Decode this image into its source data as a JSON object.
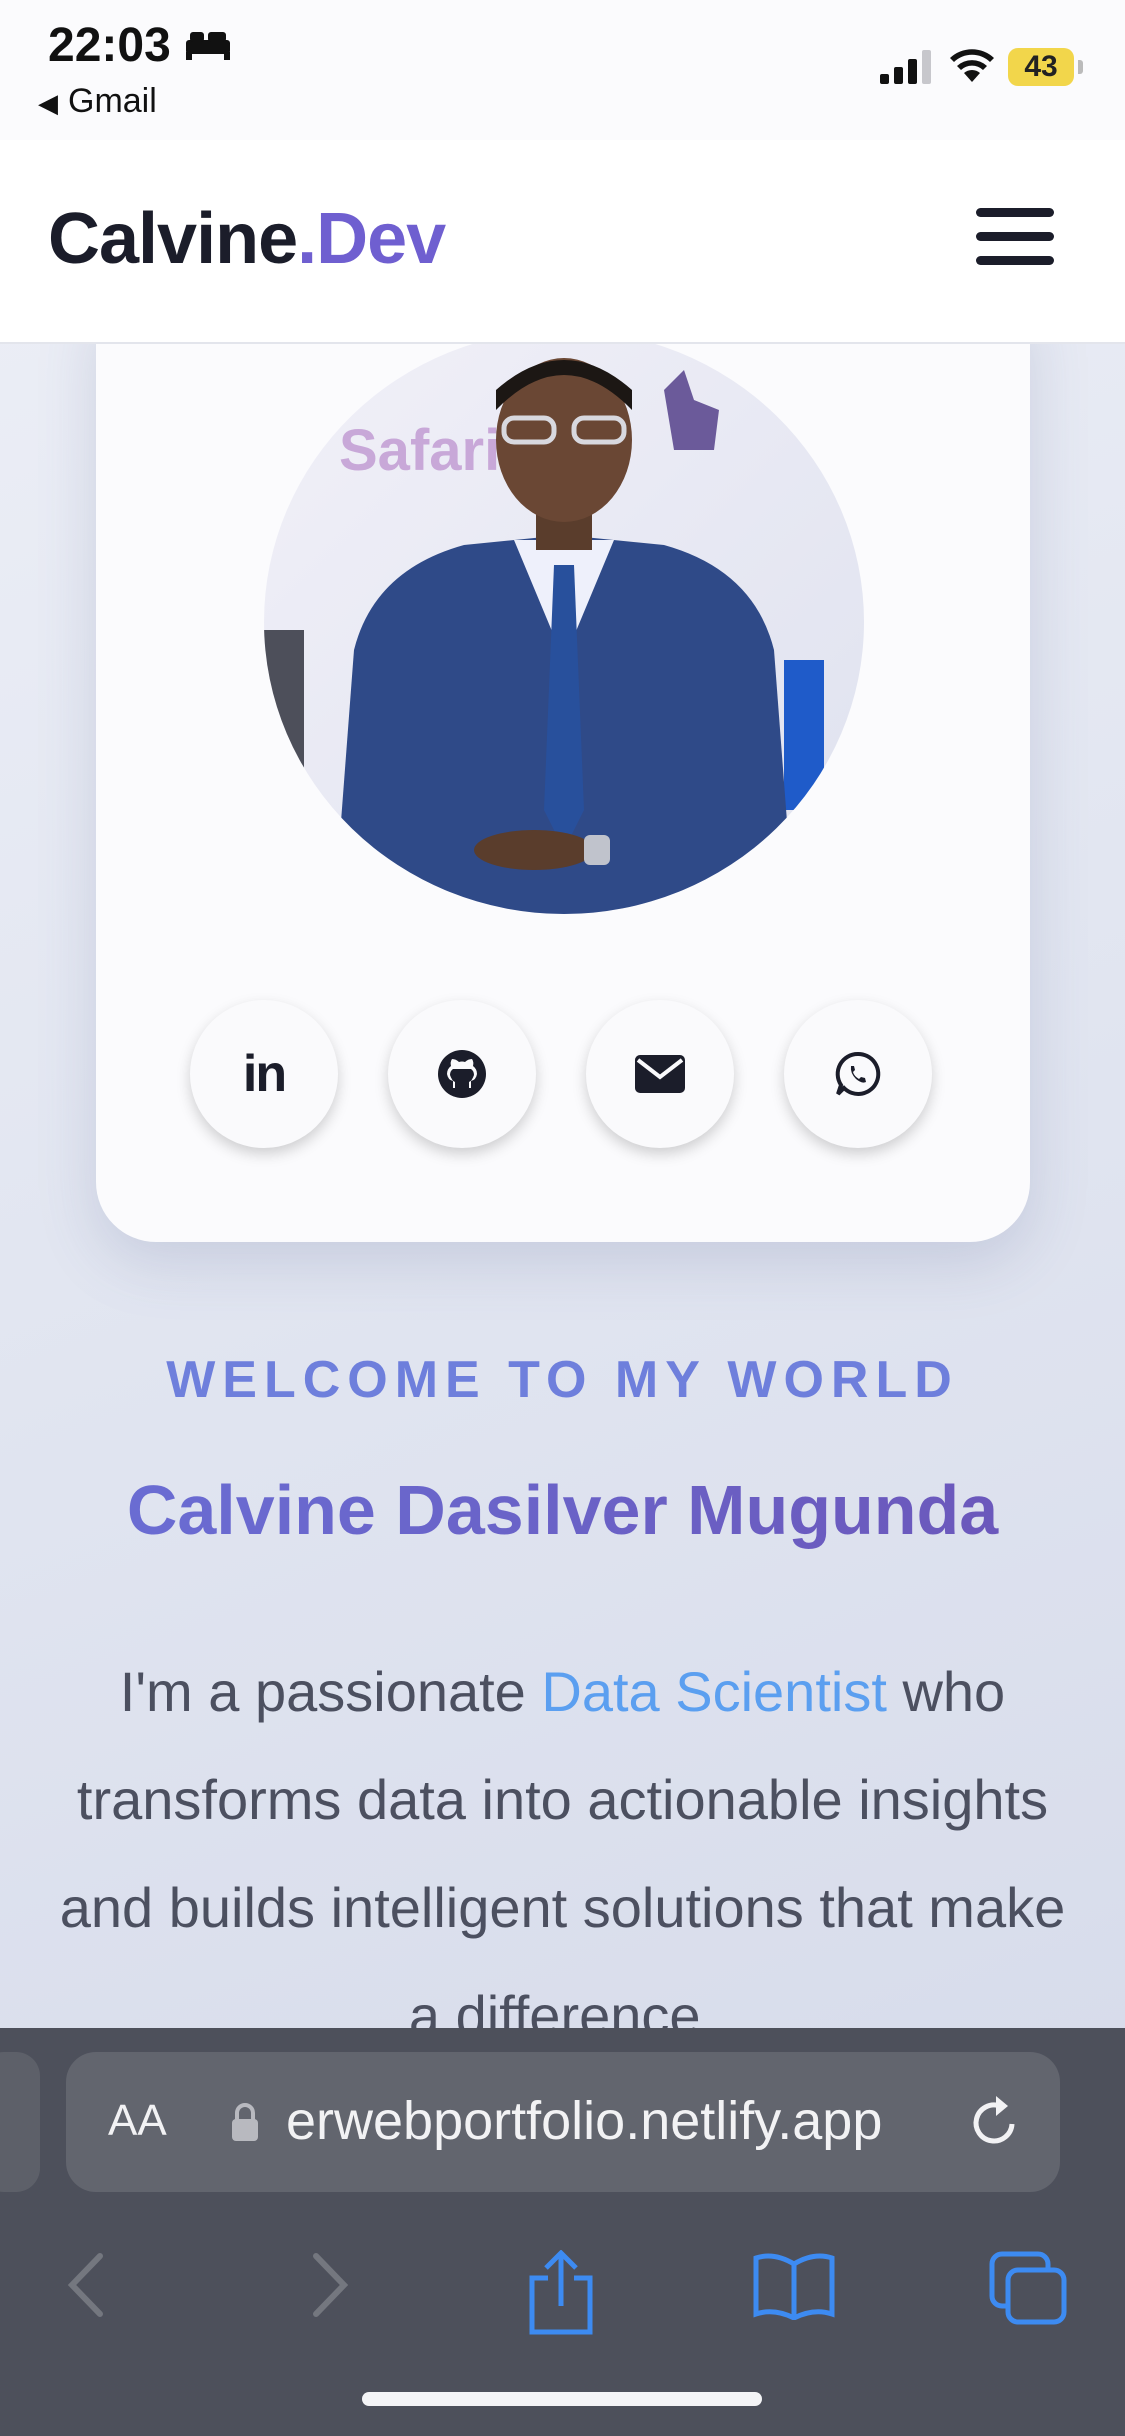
{
  "status_bar": {
    "time": "22:03",
    "back_app": "Gmail",
    "battery": "43",
    "icons": [
      "bed-icon",
      "signal-icon",
      "wifi-icon",
      "battery-icon"
    ]
  },
  "header": {
    "logo_main": "Calvine",
    "logo_accent": ".Dev",
    "menu_icon": "hamburger-icon",
    "accent_color": "#6f5fd0"
  },
  "profile": {
    "avatar_text": "Safari",
    "socials": [
      {
        "label": "in",
        "icon": "linkedin-icon"
      },
      {
        "icon": "github-icon"
      },
      {
        "icon": "email-icon"
      },
      {
        "icon": "whatsapp-icon"
      }
    ]
  },
  "hero": {
    "welcome": "WELCOME TO MY WORLD",
    "name": "Calvine Dasilver Mugunda",
    "intro_before": "I'm a passionate ",
    "intro_role": "Data Scientist",
    "intro_after": " who transforms data into actionable insights and builds intelligent solutions that make a difference.",
    "welcome_color": "#6e7fdc",
    "role_color": "#5b9ff0"
  },
  "browser": {
    "aa_label": "AA",
    "url": "erwebportfolio.netlify.app",
    "icons": [
      "lock-icon",
      "reload-icon",
      "back-icon",
      "forward-icon",
      "share-icon",
      "bookmarks-icon",
      "tabs-icon"
    ]
  }
}
